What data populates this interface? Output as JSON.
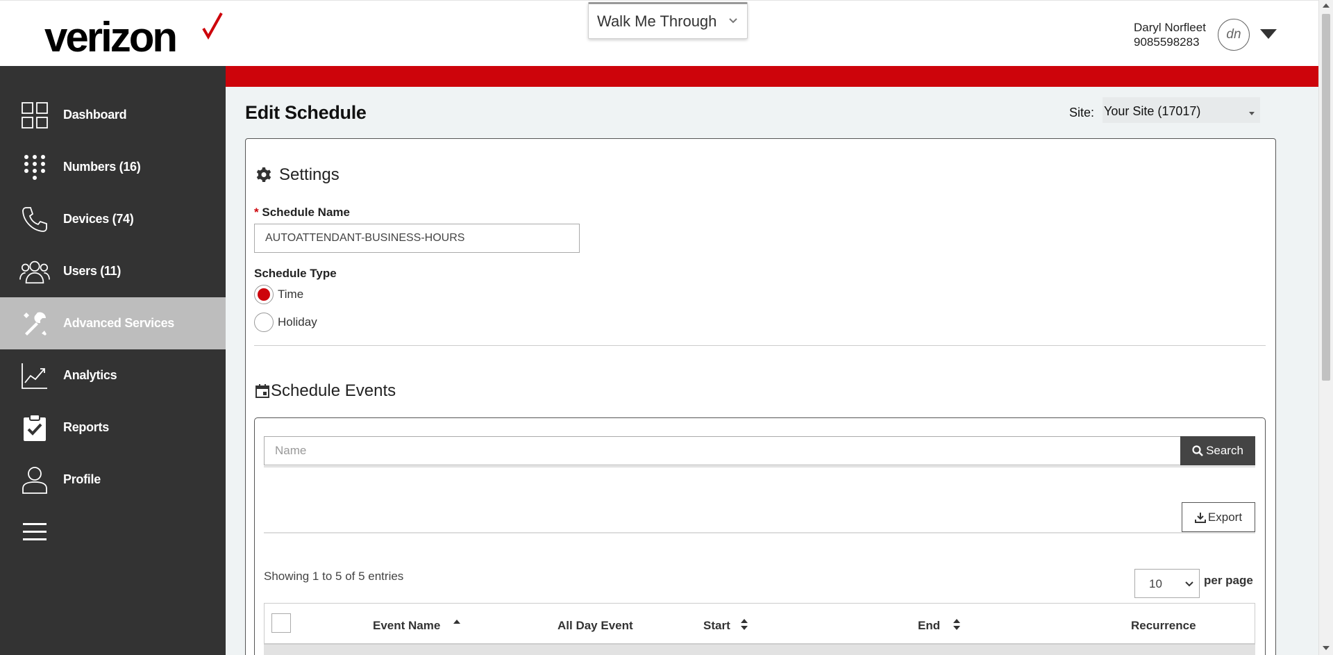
{
  "header": {
    "logo_text": "verizon",
    "walkme_label": "Walk Me Through",
    "user": {
      "name": "Daryl Norfleet",
      "phone": "9085598283",
      "initials": "dn"
    }
  },
  "sidebar": {
    "items": [
      {
        "label": "Dashboard",
        "icon": "grid-icon"
      },
      {
        "label": "Numbers (16)",
        "icon": "dialpad-icon"
      },
      {
        "label": "Devices (74)",
        "icon": "phone-icon"
      },
      {
        "label": "Users (11)",
        "icon": "users-icon"
      },
      {
        "label": "Advanced Services",
        "icon": "tools-icon",
        "active": true
      },
      {
        "label": "Analytics",
        "icon": "chart-icon"
      },
      {
        "label": "Reports",
        "icon": "clipboard-icon"
      },
      {
        "label": "Profile",
        "icon": "person-icon"
      }
    ],
    "menu_icon": "hamburger-icon"
  },
  "page": {
    "title": "Edit Schedule",
    "site_label": "Site:",
    "site_value": "Your Site (17017)"
  },
  "settings": {
    "title": "Settings",
    "schedule_name_label": "Schedule Name",
    "schedule_name_value": "AUTOATTENDANT-BUSINESS-HOURS",
    "schedule_type_label": "Schedule Type",
    "types": [
      {
        "label": "Time",
        "selected": true
      },
      {
        "label": "Holiday",
        "selected": false
      }
    ]
  },
  "events": {
    "title": "Schedule Events",
    "search_placeholder": "Name",
    "search_button": "Search",
    "export_button": "Export",
    "showing": "Showing 1 to 5 of 5 entries",
    "per_page_value": "10",
    "per_page_label": "per page",
    "columns": [
      "Event Name",
      "All Day Event",
      "Start",
      "End",
      "Recurrence"
    ]
  },
  "colors": {
    "brand_red": "#cd040b",
    "sidebar_bg": "#333333",
    "active_bg": "#bdbdbd"
  }
}
